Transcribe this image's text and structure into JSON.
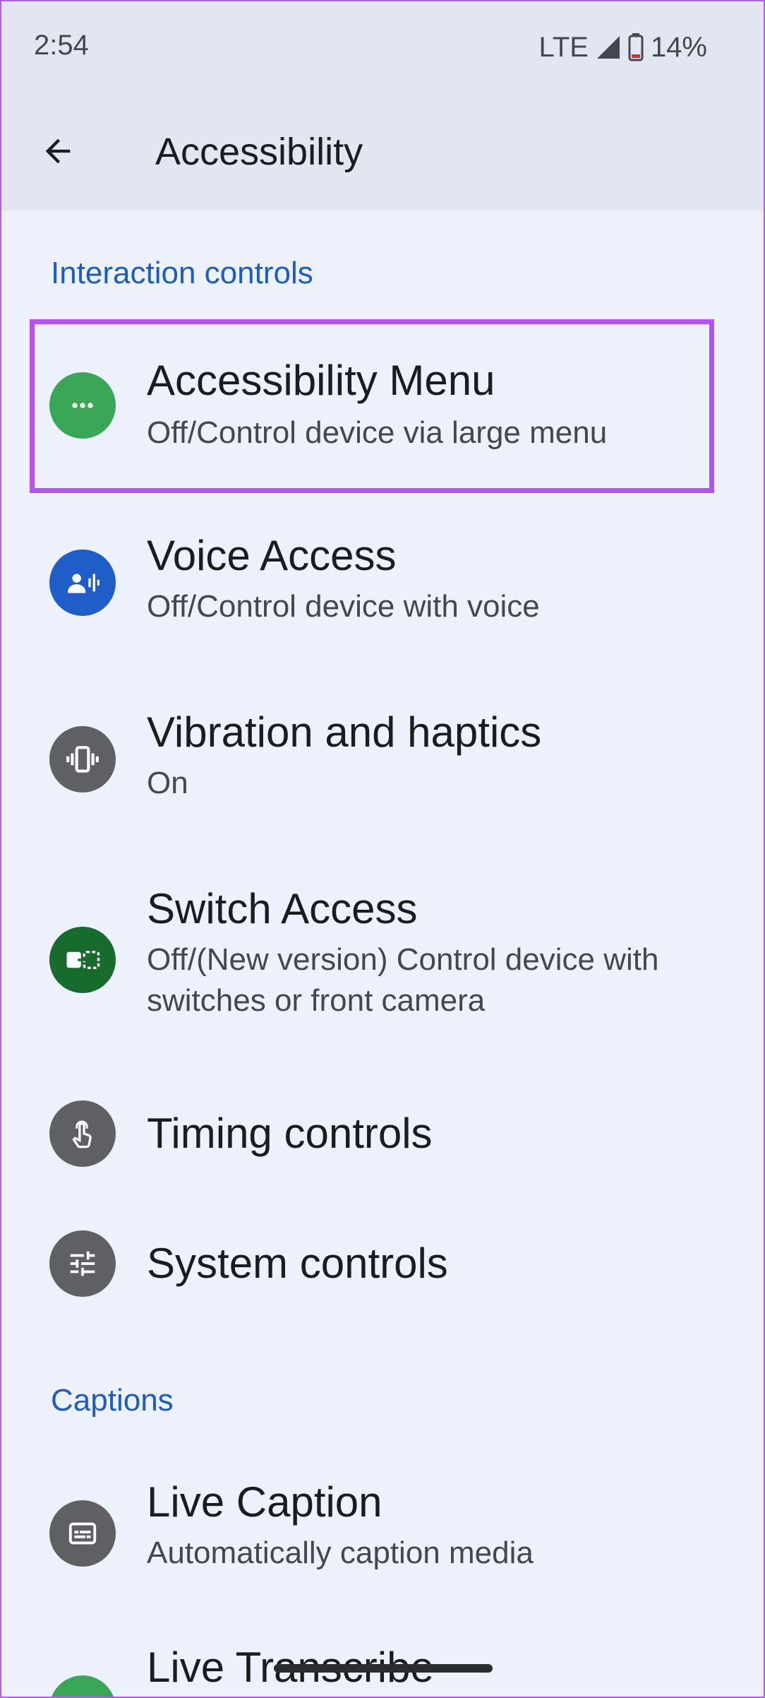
{
  "status_bar": {
    "time": "2:54",
    "network": "LTE",
    "battery": "14%"
  },
  "app_bar": {
    "title": "Accessibility",
    "back_icon": "arrow-back-icon"
  },
  "sections": [
    {
      "header": "Interaction controls",
      "items": [
        {
          "title": "Accessibility Menu",
          "subtitle": "Off/Control device via large menu",
          "icon": "more-horiz-icon",
          "icon_color": "#3aa756"
        },
        {
          "title": "Voice Access",
          "subtitle": "Off/Control device with voice",
          "icon": "voice-access-icon",
          "icon_color": "#1f5dc8"
        },
        {
          "title": "Vibration and haptics",
          "subtitle": "On",
          "icon": "vibration-icon",
          "icon_color": "#5f6063"
        },
        {
          "title": "Switch Access",
          "subtitle": "Off/(New version) Control device with switches or front camera",
          "icon": "switch-access-icon",
          "icon_color": "#176b2c"
        },
        {
          "title": "Timing controls",
          "subtitle": "",
          "icon": "touch-icon",
          "icon_color": "#5f6063"
        },
        {
          "title": "System controls",
          "subtitle": "",
          "icon": "tune-icon",
          "icon_color": "#5f6063"
        }
      ]
    },
    {
      "header": "Captions",
      "items": [
        {
          "title": "Live Caption",
          "subtitle": "Automatically caption media",
          "icon": "subtitles-icon",
          "icon_color": "#5f6063"
        },
        {
          "title": "Live Transcribe",
          "subtitle": "",
          "icon": "transcribe-icon",
          "icon_color": "#3aa756"
        }
      ]
    }
  ],
  "colors": {
    "background": "#edf1fc",
    "app_bar": "#e2e6f1",
    "section_header": "#1e5cc0",
    "highlight": "#b553f0"
  }
}
